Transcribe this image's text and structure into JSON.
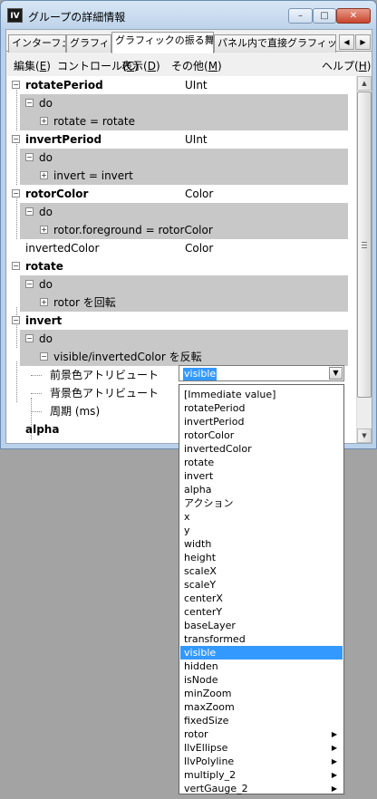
{
  "window": {
    "icon_text": "IV",
    "title": "グループの詳細情報",
    "min_label": "–",
    "max_label": "□",
    "close_label": "✕"
  },
  "tabs": [
    {
      "label": "インターフェース"
    },
    {
      "label": "グラフィック"
    },
    {
      "label": "グラフィックの振る舞い"
    },
    {
      "label": "パネル内で直接グラフィックを"
    }
  ],
  "tab_nav": {
    "left": "◀",
    "right": "▶"
  },
  "menu": [
    {
      "label": "編集(",
      "key": "E",
      "close": ")"
    },
    {
      "label": "コントロール(",
      "key": "C",
      "close": ")"
    },
    {
      "label": "表示(",
      "key": "D",
      "close": ")"
    },
    {
      "label": "その他(",
      "key": "M",
      "close": ")"
    },
    {
      "label": "ヘルプ(",
      "key": "H",
      "close": ")"
    }
  ],
  "tree": {
    "expander_minus": "−",
    "expander_plus": "+",
    "rows": [
      {
        "text": "rotatePeriod",
        "type": "UInt"
      },
      {
        "text": "do"
      },
      {
        "text": "rotate = rotate"
      },
      {
        "text": "invertPeriod",
        "type": "UInt"
      },
      {
        "text": "do"
      },
      {
        "text": "invert = invert"
      },
      {
        "text": "rotorColor",
        "type": "Color"
      },
      {
        "text": "do"
      },
      {
        "text": "rotor.foreground = rotorColor"
      },
      {
        "text": "invertedColor",
        "type": "Color"
      },
      {
        "text": "rotate"
      },
      {
        "text": "do"
      },
      {
        "text": "rotor を回転"
      },
      {
        "text": "invert"
      },
      {
        "text": "do"
      },
      {
        "text": "visible/invertedColor を反転"
      },
      {
        "text": "前景色アトリビュート"
      },
      {
        "text": "背景色アトリビュート"
      },
      {
        "text": "周期 (ms)"
      },
      {
        "text": "alpha"
      }
    ]
  },
  "scrollbar": {
    "up": "▲",
    "down": "▼"
  },
  "combo": {
    "value": "visible",
    "button": "▼"
  },
  "dropdown": {
    "submenu_arrow": "▶",
    "options": [
      {
        "label": "[Immediate value]"
      },
      {
        "label": "rotatePeriod"
      },
      {
        "label": "invertPeriod"
      },
      {
        "label": "rotorColor"
      },
      {
        "label": "invertedColor"
      },
      {
        "label": "rotate"
      },
      {
        "label": "invert"
      },
      {
        "label": "alpha"
      },
      {
        "label": "アクション"
      },
      {
        "label": "x"
      },
      {
        "label": "y"
      },
      {
        "label": "width"
      },
      {
        "label": "height"
      },
      {
        "label": "scaleX"
      },
      {
        "label": "scaleY"
      },
      {
        "label": "centerX"
      },
      {
        "label": "centerY"
      },
      {
        "label": "baseLayer"
      },
      {
        "label": "transformed"
      },
      {
        "label": "visible",
        "selected": true
      },
      {
        "label": "hidden"
      },
      {
        "label": "isNode"
      },
      {
        "label": "minZoom"
      },
      {
        "label": "maxZoom"
      },
      {
        "label": "fixedSize"
      },
      {
        "label": "rotor",
        "submenu": true
      },
      {
        "label": "IlvEllipse",
        "submenu": true
      },
      {
        "label": "IlvPolyline",
        "submenu": true
      },
      {
        "label": "multiply_2",
        "submenu": true
      },
      {
        "label": "vertGauge_2",
        "submenu": true
      }
    ]
  }
}
